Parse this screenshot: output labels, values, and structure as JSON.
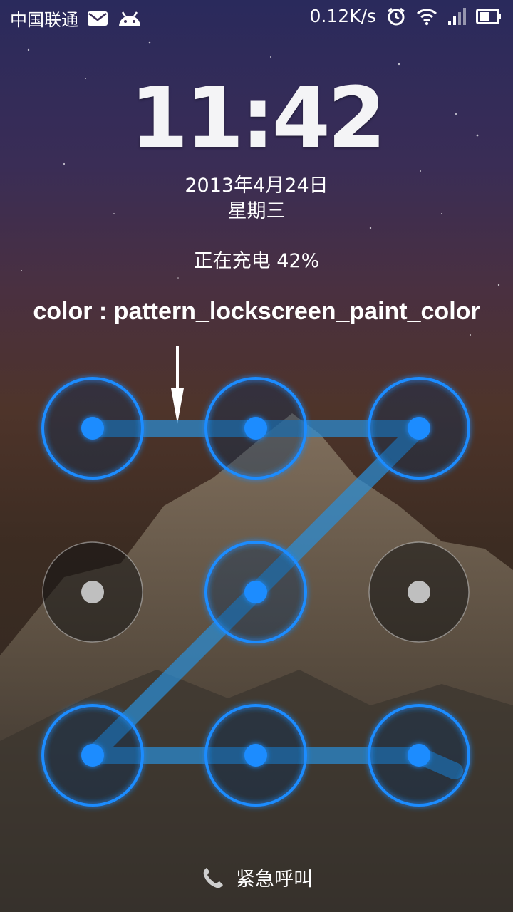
{
  "status_bar": {
    "carrier": "中国联通",
    "net_speed": "0.12K/s",
    "icons": [
      "mail-icon",
      "android-icon",
      "alarm-icon",
      "wifi-icon",
      "signal-icon",
      "battery-icon"
    ]
  },
  "lockscreen": {
    "time": "11:42",
    "date": "2013年4月24日",
    "weekday": "星期三",
    "charging": "正在充电 42%",
    "annotation": "color : pattern_lockscreen_paint_color",
    "emergency_call": "紧急呼叫"
  },
  "pattern": {
    "grid": [
      {
        "id": 1,
        "active": true
      },
      {
        "id": 2,
        "active": true
      },
      {
        "id": 3,
        "active": true
      },
      {
        "id": 4,
        "active": false
      },
      {
        "id": 5,
        "active": true
      },
      {
        "id": 6,
        "active": false
      },
      {
        "id": 7,
        "active": true
      },
      {
        "id": 8,
        "active": true
      },
      {
        "id": 9,
        "active": true
      }
    ],
    "path": [
      1,
      2,
      3,
      5,
      7,
      8,
      9
    ],
    "colors": {
      "active": "#1a8cff",
      "inactive": "#bfbfbf",
      "line": "#2a8fd8"
    }
  }
}
